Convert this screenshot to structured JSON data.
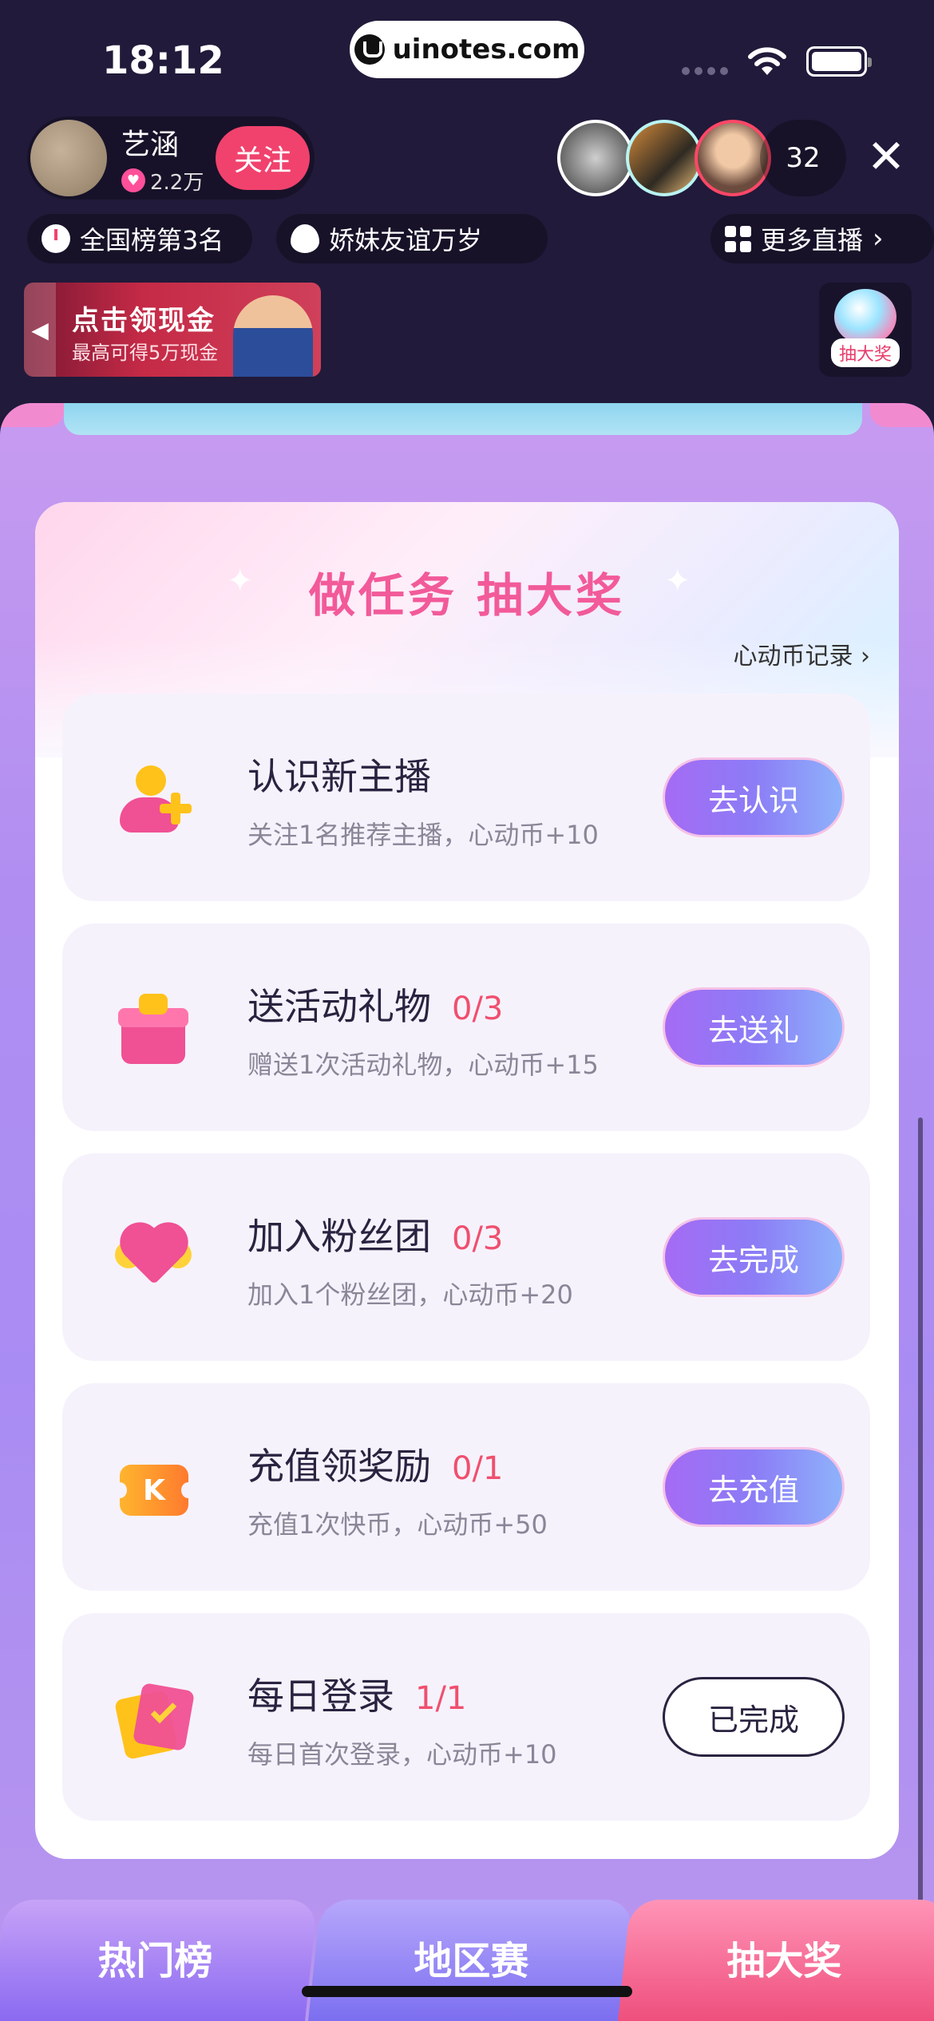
{
  "status_bar": {
    "time": "18:12",
    "url": "uinotes.com"
  },
  "anchor": {
    "name": "艺涵",
    "likes": "2.2万",
    "follow_label": "关注"
  },
  "viewers": {
    "count": "32"
  },
  "tags": {
    "rank": "全国榜第3名",
    "fan_group": "娇妹友谊万岁",
    "more_live": "更多直播"
  },
  "cash_banner": {
    "title": "点击领现金",
    "subtitle": "最高可得5万现金"
  },
  "lottery_badge": {
    "label": "抽大奖"
  },
  "task_card": {
    "title": "做任务 抽大奖",
    "coin_record": "心动币记录",
    "tasks": [
      {
        "name": "认识新主播",
        "progress": "",
        "desc": "关注1名推荐主播，心动币+10",
        "button": "去认识",
        "icon": "person-plus-icon"
      },
      {
        "name": "送活动礼物",
        "progress": "0/3",
        "desc": "赠送1次活动礼物，心动币+15",
        "button": "去送礼",
        "icon": "gift-icon"
      },
      {
        "name": "加入粉丝团",
        "progress": "0/3",
        "desc": "加入1个粉丝团，心动币+20",
        "button": "去完成",
        "icon": "winged-heart-icon"
      },
      {
        "name": "充值领奖励",
        "progress": "0/1",
        "desc": "充值1次快币，心动币+50",
        "button": "去充值",
        "icon": "coin-ticket-icon"
      },
      {
        "name": "每日登录",
        "progress": "1/1",
        "desc": "每日首次登录，心动币+10",
        "button": "已完成",
        "icon": "checkin-card-icon"
      }
    ]
  },
  "bottom_tabs": {
    "hot": "热门榜",
    "region": "地区赛",
    "lottery": "抽大奖"
  },
  "colors": {
    "accent_pink": "#f25a99",
    "progress_red": "#f04f6e",
    "follow_red": "#f0426d",
    "panel_purple": "#a98cf3"
  }
}
